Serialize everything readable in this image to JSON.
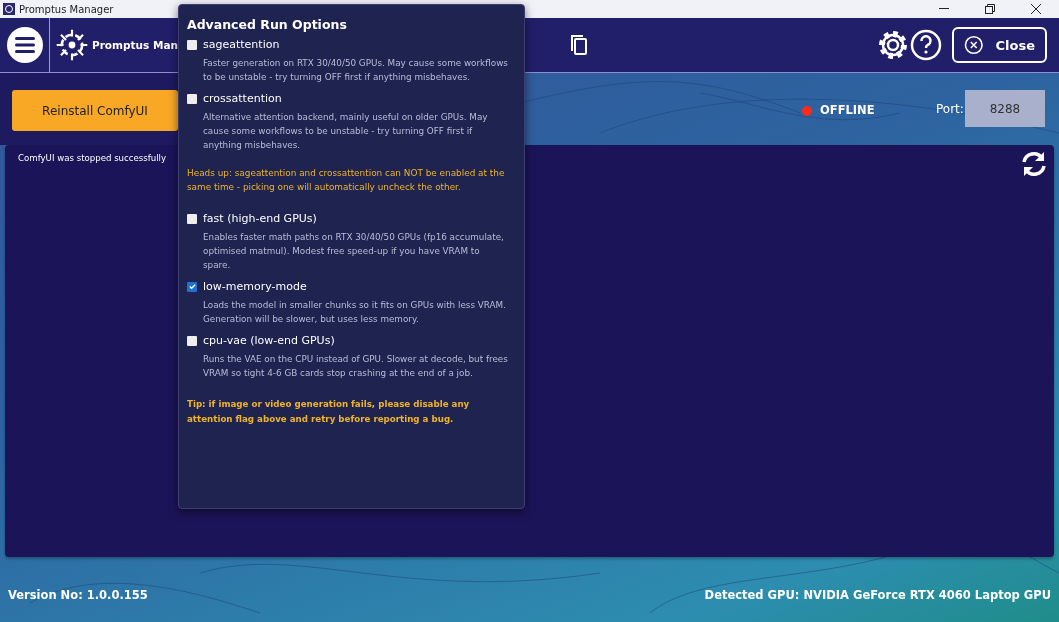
{
  "window": {
    "title": "Promptus Manager"
  },
  "header": {
    "app_name": "Promptus Man",
    "close_label": "Close"
  },
  "left": {
    "reinstall_label": "Reinstall ComfyUI",
    "status_message": "ComfyUI was stopped successfully"
  },
  "server": {
    "status": "OFFLINE",
    "online": false,
    "port_label": "Port:",
    "port_value": "8288"
  },
  "popup": {
    "title": "Advanced Run Options",
    "items": [
      {
        "kind": "option",
        "label": "sageattention",
        "checked": false,
        "description": "Faster generation on RTX 30/40/50 GPUs. May cause some workflows to be unstable - try turning OFF first if anything misbehaves."
      },
      {
        "kind": "option",
        "label": "crossattention",
        "checked": false,
        "description": "Alternative attention backend, mainly useful on older GPUs. May cause some workflows to be unstable - try turning OFF first if anything misbehaves."
      },
      {
        "kind": "note",
        "text": "Heads up: sageattention and crossattention can NOT be enabled at the same time - picking one will automatically uncheck the other."
      },
      {
        "kind": "option",
        "label": "fast (high-end GPUs)",
        "checked": false,
        "description": "Enables faster math paths on RTX 30/40/50 GPUs (fp16 accumulate, optimised matmul). Modest free speed-up if you have VRAM to spare."
      },
      {
        "kind": "option",
        "label": "low-memory-mode",
        "checked": true,
        "description": "Loads the model in smaller chunks so it fits on GPUs with less VRAM. Generation will be slower, but uses less memory."
      },
      {
        "kind": "option",
        "label": "cpu-vae (low-end GPUs)",
        "checked": false,
        "description": "Runs the VAE on the CPU instead of GPU. Slower at decode, but frees VRAM so tight 4-6 GB cards stop crashing at the end of a job."
      },
      {
        "kind": "tip",
        "text": "Tip: if image or video generation fails, please disable any attention flag above and retry before reporting a bug."
      }
    ]
  },
  "footer": {
    "version": "Version No: 1.0.0.155",
    "gpu": "Detected GPU: NVIDIA GeForce RTX 4060 Laptop GPU"
  }
}
